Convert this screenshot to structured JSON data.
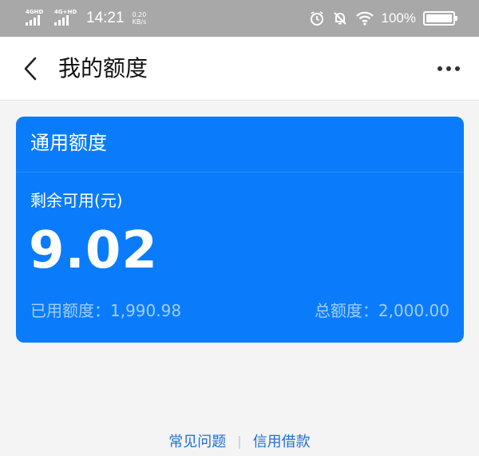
{
  "status_bar": {
    "sim1_label": "4GHD",
    "sim2_label": "4G+HD",
    "time": "14:21",
    "speed_value": "0.20",
    "speed_unit": "KB/s",
    "battery_text": "100%",
    "icons": [
      "alarm-icon",
      "mute-bell-icon",
      "wifi-icon",
      "battery-icon"
    ]
  },
  "nav": {
    "title": "我的额度",
    "back_icon": "chevron-left-icon",
    "more_icon": "more-dots-icon"
  },
  "card": {
    "title": "通用额度",
    "label": "剩余可用(元)",
    "amount": "9.02",
    "used": "已用额度：1,990.98",
    "total": "总额度：2,000.00",
    "accent_color": "#0a7cfb"
  },
  "footer": {
    "link_faq": "常见问题",
    "separator": "|",
    "link_credit": "信用借款",
    "link_color": "#1f6fd1"
  }
}
